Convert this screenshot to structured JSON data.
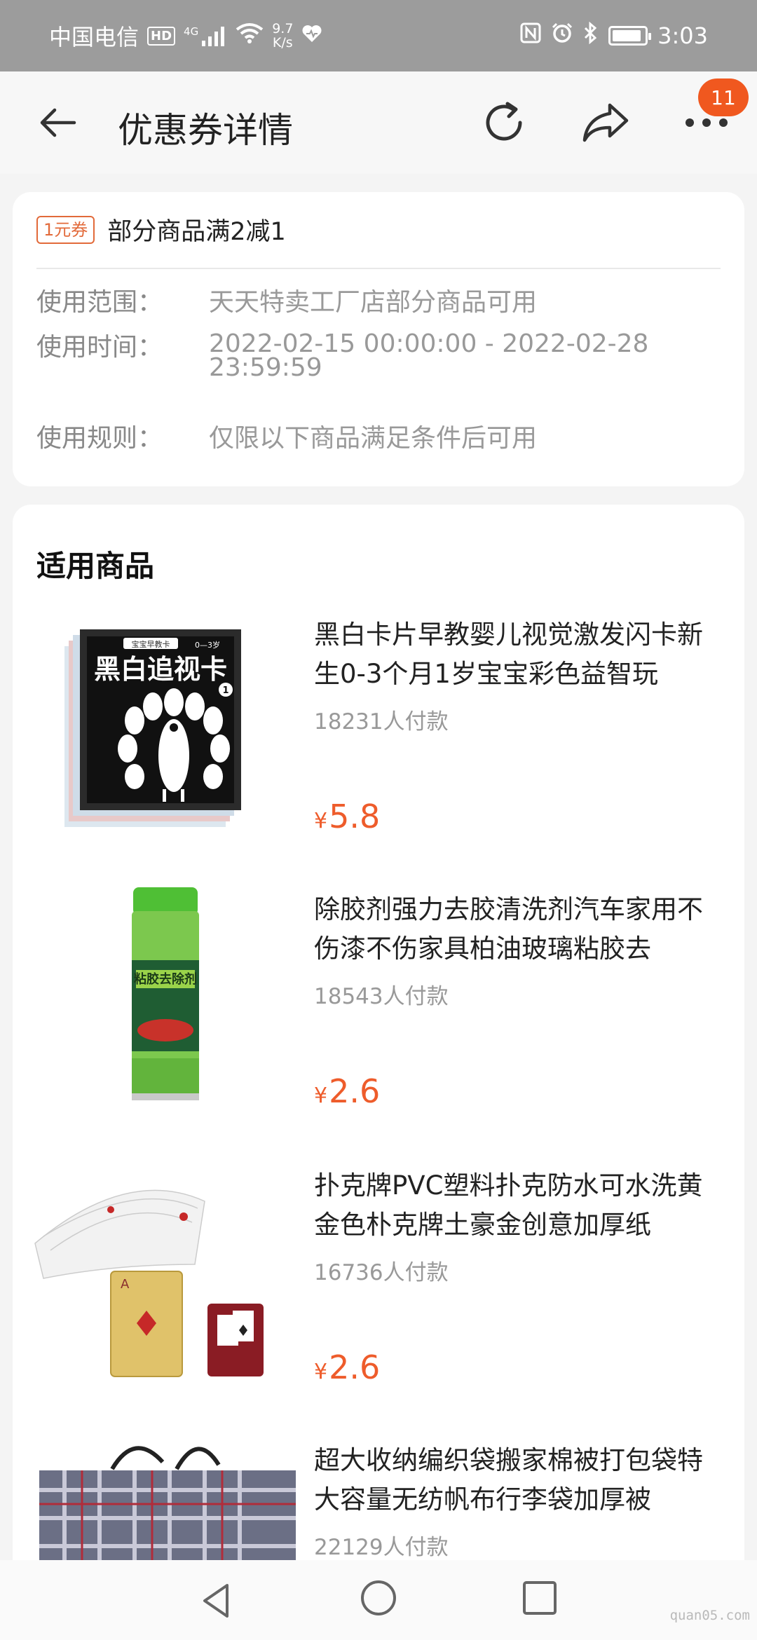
{
  "status_bar": {
    "carrier": "中国电信",
    "hd": "HD",
    "network": "4G",
    "speed_value": "9.7",
    "speed_unit": "K/s",
    "time": "3:03",
    "icons": [
      "signal-icon",
      "wifi-icon",
      "heart-icon",
      "nfc-icon",
      "alarm-icon",
      "bluetooth-icon",
      "battery-icon"
    ]
  },
  "header": {
    "title": "优惠券详情",
    "badge_count": "11",
    "icons": [
      "back-arrow-icon",
      "refresh-icon",
      "share-icon",
      "more-icon"
    ]
  },
  "coupon": {
    "tag": "1元券",
    "title": "部分商品满2减1",
    "rows": [
      {
        "label": "使用范围：",
        "value": "天天特卖工厂店部分商品可用"
      },
      {
        "label": "使用时间：",
        "value": "2022-02-15 00:00:00 - 2022-02-28 23:59:59"
      },
      {
        "label": "使用规则：",
        "value": "仅限以下商品满足条件后可用"
      }
    ]
  },
  "products": {
    "section_title": "适用商品",
    "items": [
      {
        "title": "黑白卡片早教婴儿视觉激发闪卡新生0-3个月1岁宝宝彩色益智玩",
        "sales": "18231人付款",
        "currency": "¥",
        "price": "5.8",
        "image_text": "黑白追视卡",
        "image_subtext": "宝宝早教卡",
        "image_age": "0—3岁"
      },
      {
        "title": "除胶剂强力去胶清洗剂汽车家用不伤漆不伤家具柏油玻璃粘胶去",
        "sales": "18543人付款",
        "currency": "¥",
        "price": "2.6",
        "image_text": "粘胶去除剂"
      },
      {
        "title": "扑克牌PVC塑料扑克防水可水洗黄金色朴克牌土豪金创意加厚纸",
        "sales": "16736人付款",
        "currency": "¥",
        "price": "2.6"
      },
      {
        "title": "超大收纳编织袋搬家棉被打包袋特大容量无纺帆布行李袋加厚被",
        "sales": "22129人付款",
        "currency": "¥",
        "price": ""
      }
    ]
  },
  "nav": {
    "watermark": "quan05.com"
  },
  "colors": {
    "accent": "#ee5c2b",
    "badge": "#f0581f",
    "status_bar": "#9c9c9c"
  }
}
